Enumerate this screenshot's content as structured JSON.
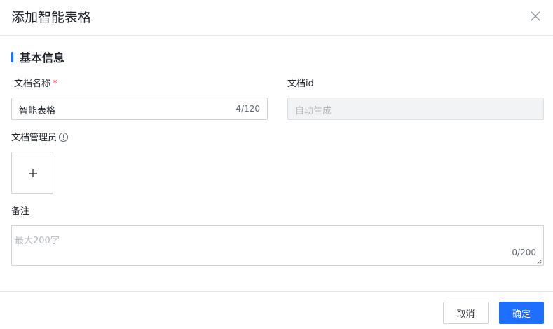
{
  "dialog": {
    "title": "添加智能表格"
  },
  "section": {
    "title": "基本信息"
  },
  "form": {
    "doc_name": {
      "label": "文档名称",
      "required_mark": "*",
      "value": "智能表格",
      "count": "4/120"
    },
    "doc_id": {
      "label": "文档id",
      "placeholder": "自动生成"
    },
    "doc_admin": {
      "label": "文档管理员"
    },
    "remark": {
      "label": "备注",
      "placeholder": "最大200字",
      "count": "0/200"
    }
  },
  "footer": {
    "cancel_label": "取消",
    "confirm_label": "确定"
  },
  "colors": {
    "accent": "#1e6fff",
    "required": "#f53f3f"
  },
  "icons": {
    "close": "close-icon",
    "info": "info-icon",
    "add": "plus-icon"
  }
}
